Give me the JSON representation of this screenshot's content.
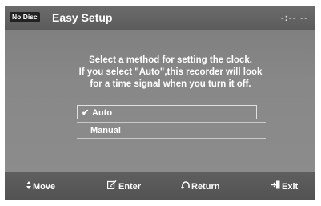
{
  "header": {
    "disc_status": "No Disc",
    "title": "Easy Setup",
    "clock": "-:-- --"
  },
  "prompt": {
    "lines": [
      "Select a method for setting the clock.",
      "If you select \"Auto\",this recorder will look",
      "for a time signal when you turn it off."
    ]
  },
  "options": [
    {
      "label": "Auto",
      "checkmark": "✔",
      "selected": true
    },
    {
      "label": "Manual",
      "selected": false
    }
  ],
  "footer": {
    "move": {
      "icon": "up-down-arrows-icon",
      "label": "Move"
    },
    "enter": {
      "icon": "enter-icon",
      "label": "Enter"
    },
    "return": {
      "icon": "return-arrow-icon",
      "label": "Return"
    },
    "exit": {
      "icon": "exit-door-icon",
      "label": "Exit"
    }
  },
  "colors": {
    "background": "#888888",
    "bar": "#5c5c5c",
    "text": "#ffffff"
  }
}
